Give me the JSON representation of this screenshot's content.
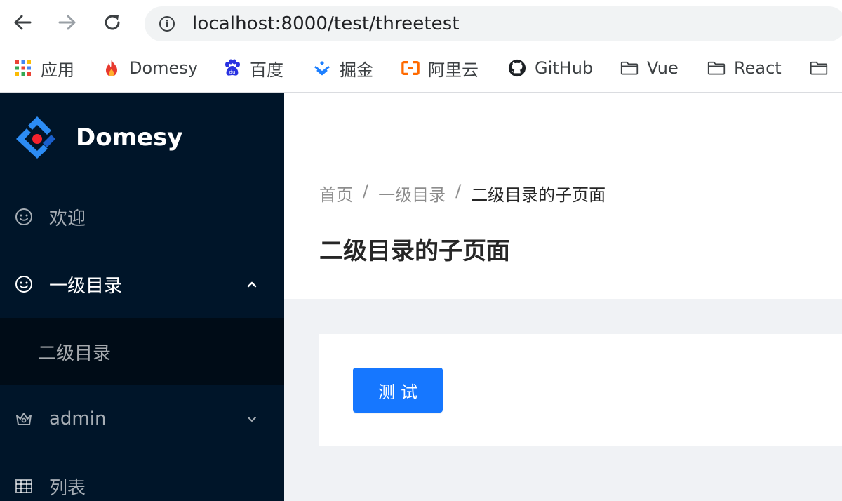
{
  "browser": {
    "url": "localhost:8000/test/threetest",
    "nav": {
      "back_icon": "arrow-left-icon",
      "forward_icon": "arrow-right-icon",
      "reload_icon": "reload-icon",
      "site_info_icon": "info-icon"
    },
    "bookmarks": [
      {
        "label": "应用",
        "icon": "apps-grid-icon"
      },
      {
        "label": "Domesy",
        "icon": "flame-icon"
      },
      {
        "label": "百度",
        "icon": "baidu-paw-icon"
      },
      {
        "label": "掘金",
        "icon": "juejin-icon"
      },
      {
        "label": "阿里云",
        "icon": "aliyun-icon"
      },
      {
        "label": "GitHub",
        "icon": "github-icon"
      },
      {
        "label": "Vue",
        "icon": "folder-icon"
      },
      {
        "label": "React",
        "icon": "folder-icon"
      },
      {
        "label": "",
        "icon": "folder-icon"
      }
    ]
  },
  "sidebar": {
    "logo_text": "Domesy",
    "items": [
      {
        "label": "欢迎",
        "icon": "smile-icon"
      },
      {
        "label": "一级目录",
        "icon": "smile-icon",
        "expanded": true
      },
      {
        "label": "admin",
        "icon": "crown-icon",
        "expanded": false
      },
      {
        "label": "列表",
        "icon": "table-icon"
      }
    ],
    "submenu": [
      {
        "label": "二级目录"
      }
    ]
  },
  "main": {
    "breadcrumb": [
      "首页",
      "一级目录",
      "二级目录的子页面"
    ],
    "breadcrumb_separator": "/",
    "title": "二级目录的子页面",
    "test_button_label": "测试"
  },
  "colors": {
    "sidebar_bg": "#001529",
    "submenu_bg": "#000c17",
    "primary": "#1677ff",
    "content_bg": "#f0f2f5"
  }
}
